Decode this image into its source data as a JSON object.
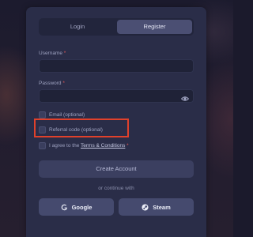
{
  "tabs": {
    "login": "Login",
    "register": "Register",
    "active": "Register"
  },
  "fields": {
    "username": {
      "label": "Username",
      "required_mark": "*",
      "value": ""
    },
    "password": {
      "label": "Password",
      "required_mark": "*",
      "value": "",
      "toggle_icon": "eye-icon"
    }
  },
  "checkboxes": {
    "email": {
      "label": "Email (optional)",
      "checked": false
    },
    "referral": {
      "label": "Referral code (optional)",
      "checked": false,
      "highlighted": true
    },
    "terms": {
      "prefix": "I agree to the ",
      "link": "Terms & Conditions",
      "required_mark": "*",
      "checked": false
    }
  },
  "actions": {
    "create_account": "Create Account",
    "divider_text": "or continue with",
    "google": {
      "label": "Google",
      "icon": "google-icon"
    },
    "steam": {
      "label": "Steam",
      "icon": "steam-icon"
    }
  },
  "colors": {
    "highlight": "#e0412b",
    "panel": "#2a2d48",
    "required": "#e05858"
  }
}
